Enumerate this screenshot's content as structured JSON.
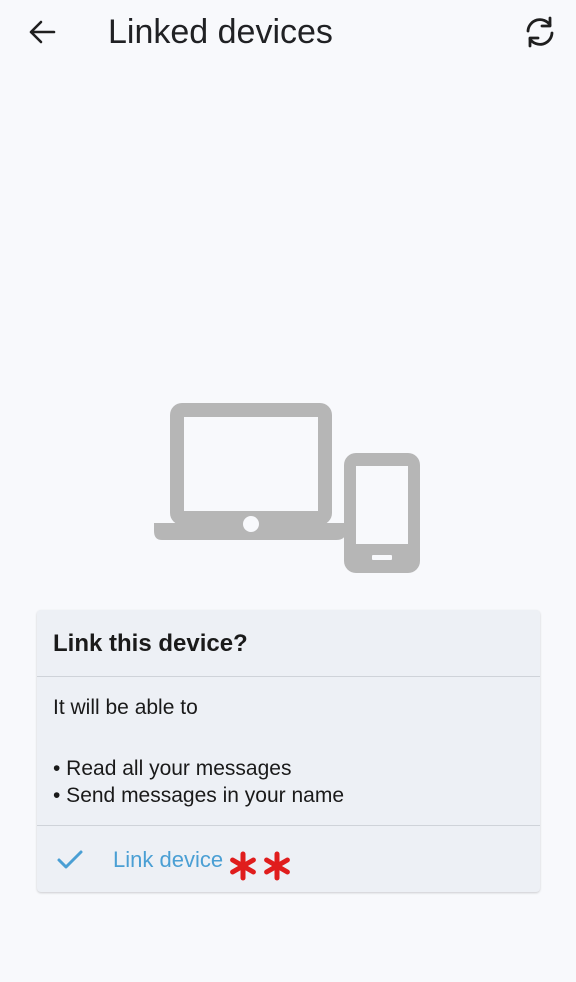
{
  "header": {
    "title": "Linked devices",
    "back_icon": "arrow-left-icon",
    "refresh_icon": "refresh-icon"
  },
  "illustration": {
    "icon": "laptop-and-phone-icon",
    "color": "#b6b6b6"
  },
  "dialog": {
    "title": "Link this device?",
    "intro": "It will be able to",
    "bullets": [
      "• Read all your messages",
      "• Send messages in your name"
    ],
    "action": {
      "icon": "checkmark-icon",
      "label": "Link device",
      "annotation_icon": "red-asterisks-icon"
    }
  },
  "colors": {
    "background": "#f8f9fc",
    "card": "#edf0f5",
    "accent": "#4a9fd4",
    "annotation": "#e01d1d"
  }
}
